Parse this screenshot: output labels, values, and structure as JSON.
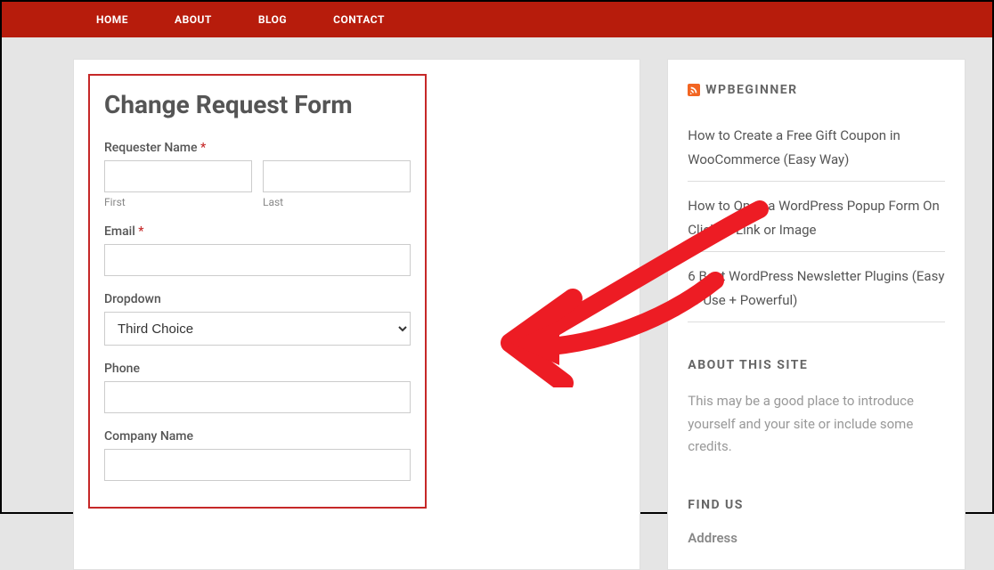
{
  "nav": {
    "items": [
      "HOME",
      "ABOUT",
      "BLOG",
      "CONTACT"
    ]
  },
  "form": {
    "title": "Change Request Form",
    "requester_label": "Requester Name",
    "first_sub": "First",
    "last_sub": "Last",
    "email_label": "Email",
    "dropdown_label": "Dropdown",
    "dropdown_value": "Third Choice",
    "phone_label": "Phone",
    "company_label": "Company Name"
  },
  "sidebar": {
    "rss_title": "WPBEGINNER",
    "posts": [
      "How to Create a Free Gift Coupon in WooCommerce (Easy Way)",
      "How to Open a WordPress Popup Form On Click of Link or Image",
      "6 Best WordPress Newsletter Plugins (Easy to Use + Powerful)"
    ],
    "about_title": "ABOUT THIS SITE",
    "about_text": "This may be a good place to introduce yourself and your site or include some credits.",
    "findus_title": "FIND US",
    "address_label": "Address"
  }
}
